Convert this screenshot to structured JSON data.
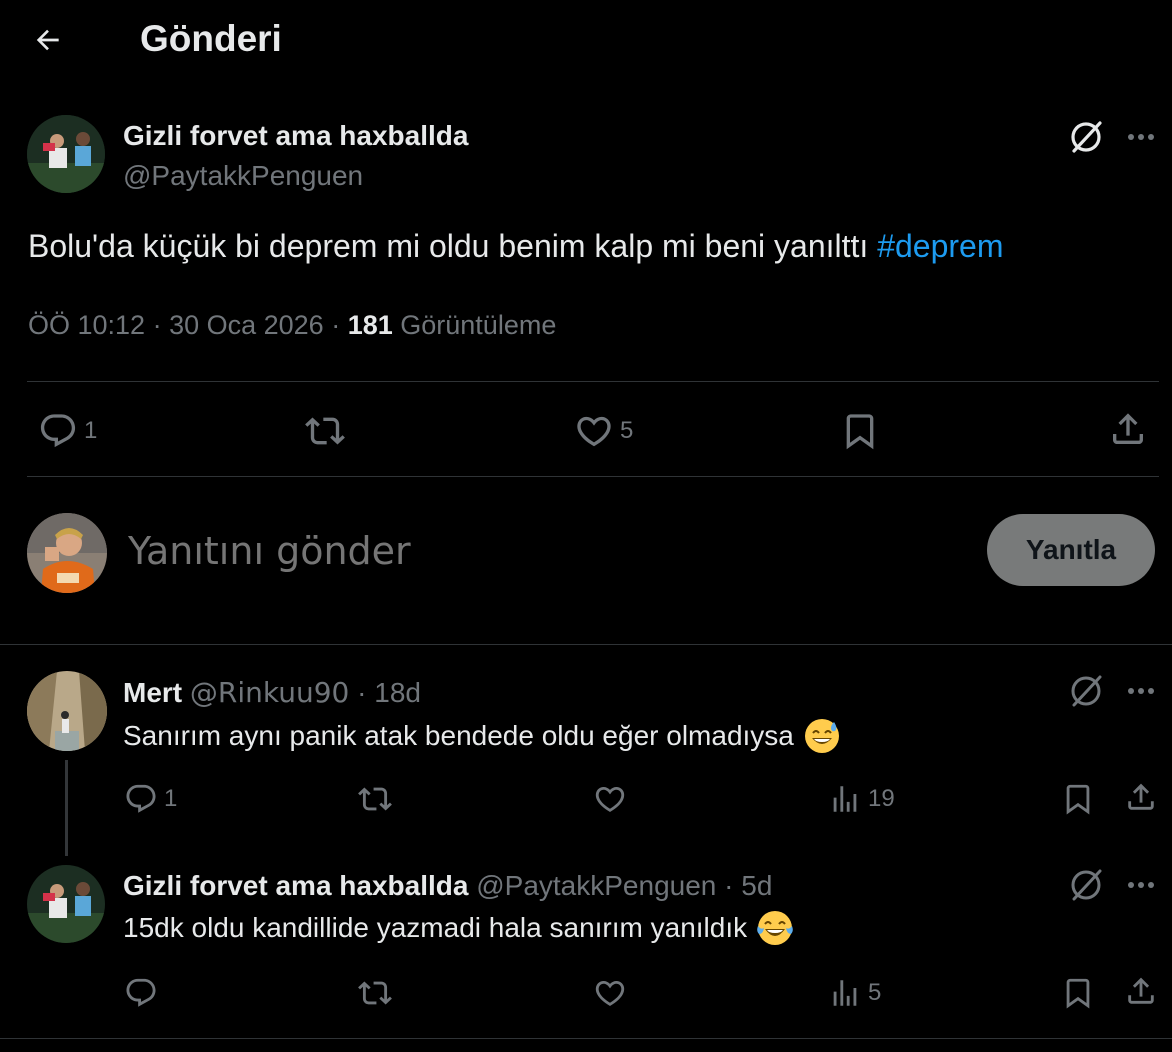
{
  "header": {
    "title": "Gönderi"
  },
  "main_post": {
    "author_name": "Gizli forvet ama haxballda",
    "author_handle": "@PaytakkPenguen",
    "text": "Bolu'da küçük bi deprem mi oldu benim kalp mi beni yanılttı",
    "hashtag": "#deprem",
    "time": "ÖÖ 10:12",
    "sep1": " · ",
    "date": "30 Oca 2026",
    "sep2": " · ",
    "views_count": "181",
    "views_label": " Görüntüleme",
    "reply_count": "1",
    "like_count": "5"
  },
  "composer": {
    "placeholder": "Yanıtını gönder",
    "button_label": "Yanıtla"
  },
  "replies": [
    {
      "name": "Mert",
      "handle": "@Rinkuu90",
      "sep": " · ",
      "age": "18d",
      "text": "Sanırım aynı panik atak bendede oldu eğer olmadıysa",
      "emoji": "sweat-smile",
      "reply_count": "1",
      "views": "19"
    },
    {
      "name": "Gizli forvet ama haxballda",
      "handle": "@PaytakkPenguen",
      "sep": " · ",
      "age": "5d",
      "text": "15dk oldu kandillide yazmadi hala sanırım yanıldık",
      "emoji": "tears-of-joy",
      "reply_count": "",
      "views": "5"
    }
  ],
  "colors": {
    "accent": "#1d9bf0",
    "muted": "#71767b",
    "text": "#e7e9ea",
    "divider": "#2f3336",
    "button": "#787a7a"
  }
}
